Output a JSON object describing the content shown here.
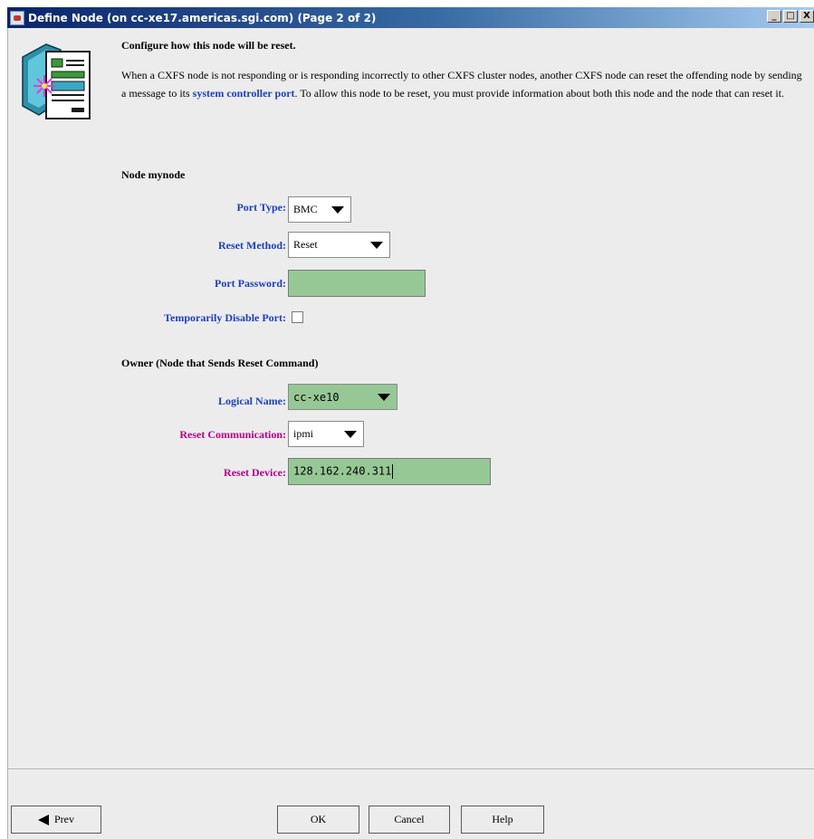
{
  "window": {
    "title": "Define Node (on cc-xe17.americas.sgi.com) (Page 2 of 2)",
    "controls": {
      "minimize": "_",
      "maximize": "□",
      "close": "X"
    }
  },
  "intro": {
    "heading": "Configure how this node will be reset.",
    "paragraph_before": "When a CXFS node is not responding or is responding incorrectly to other CXFS cluster nodes, another CXFS node can reset the offending node by sending a message to its ",
    "link_text": "system controller port",
    "paragraph_after": ".  To allow this node to be reset, you must provide information about both this node and the node that can reset it."
  },
  "node_section": {
    "title": "Node mynode",
    "port_type": {
      "label": "Port Type:",
      "value": "BMC"
    },
    "reset_method": {
      "label": "Reset Method:",
      "value": "Reset"
    },
    "port_password": {
      "label": "Port Password:",
      "value": ""
    },
    "disable_port": {
      "label": "Temporarily Disable Port:",
      "checked": false
    }
  },
  "owner_section": {
    "title": "Owner (Node that Sends Reset Command)",
    "logical_name": {
      "label": "Logical Name:",
      "value": "cc-xe10"
    },
    "reset_communication": {
      "label": "Reset Communication:",
      "value": "ipmi"
    },
    "reset_device": {
      "label": "Reset Device:",
      "value": "128.162.240.311"
    }
  },
  "buttons": {
    "prev": "Prev",
    "ok": "OK",
    "cancel": "Cancel",
    "help": "Help"
  },
  "colors": {
    "label_blue": "#1a3fbf",
    "label_magenta": "#b5008c",
    "field_green": "#96c896",
    "title_gradient_start": "#0a246a"
  }
}
